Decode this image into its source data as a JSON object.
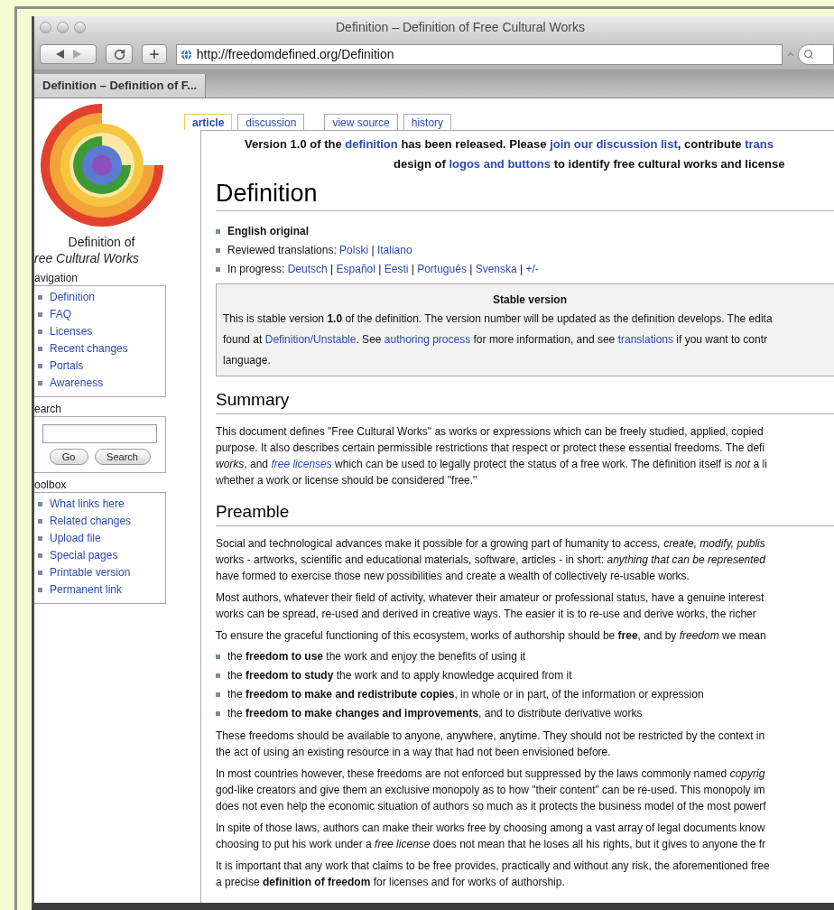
{
  "window": {
    "title": "Definition – Definition of Free Cultural Works"
  },
  "toolbar": {
    "url": "http://freedomdefined.org/Definition"
  },
  "browser_tabs": [
    {
      "label": "Definition – Definition of F...",
      "selected": true
    }
  ],
  "sidebar": {
    "site_name": "Definition of",
    "site_subtitle": "ree Cultural Works",
    "portlets": [
      {
        "kind": "links",
        "title": "avigation",
        "items": [
          "Definition",
          "FAQ",
          "Licenses",
          "Recent changes",
          "Portals",
          "Awareness"
        ]
      },
      {
        "kind": "search",
        "title": "earch",
        "buttons": [
          "Go",
          "Search"
        ]
      },
      {
        "kind": "links",
        "title": "oolbox",
        "items": [
          "What links here",
          "Related changes",
          "Upload file",
          "Special pages",
          "Printable version",
          "Permanent link"
        ]
      }
    ]
  },
  "page_tabs": [
    {
      "label": "article",
      "selected": true
    },
    {
      "label": "discussion",
      "selected": false
    },
    {
      "label": "view source",
      "selected": false
    },
    {
      "label": "history",
      "selected": false
    }
  ],
  "site_notice": [
    [
      {
        "kind": "text",
        "text": "Version 1.0 of the "
      },
      {
        "kind": "link",
        "text": "definition"
      },
      {
        "kind": "text",
        "text": " has been released. Please "
      },
      {
        "kind": "link",
        "text": "join our discussion list"
      },
      {
        "kind": "text",
        "text": ", contribute "
      },
      {
        "kind": "link",
        "text": "trans"
      }
    ],
    [
      {
        "kind": "text",
        "text": "design of "
      },
      {
        "kind": "link",
        "text": "logos and buttons"
      },
      {
        "kind": "text",
        "text": " to identify free cultural works and license"
      }
    ]
  ],
  "heading": "Definition",
  "languages": [
    [
      {
        "kind": "text",
        "text": "**English original**"
      }
    ],
    [
      {
        "kind": "text",
        "text": "Reviewed translations: "
      },
      {
        "kind": "link",
        "text": "Polski"
      },
      {
        "kind": "text",
        "text": " | "
      },
      {
        "kind": "link",
        "text": "Italiano"
      }
    ],
    [
      {
        "kind": "text",
        "text": "In progress: "
      },
      {
        "kind": "link",
        "text": "Deutsch"
      },
      {
        "kind": "text",
        "text": " | "
      },
      {
        "kind": "link",
        "text": "Español"
      },
      {
        "kind": "text",
        "text": " | "
      },
      {
        "kind": "link",
        "text": "Eesti"
      },
      {
        "kind": "text",
        "text": " | "
      },
      {
        "kind": "link",
        "text": "Português"
      },
      {
        "kind": "text",
        "text": " | "
      },
      {
        "kind": "link",
        "text": "Svenska"
      },
      {
        "kind": "text",
        "text": " | "
      },
      {
        "kind": "link",
        "text": "+/-"
      }
    ]
  ],
  "stable_box": {
    "title": "Stable version",
    "lines": [
      [
        {
          "kind": "text",
          "text": "This is stable version **1.0** of the definition. The version number will be updated as the definition develops. The edita"
        }
      ],
      [
        {
          "kind": "text",
          "text": "found at "
        },
        {
          "kind": "link",
          "text": "Definition/Unstable"
        },
        {
          "kind": "text",
          "text": ". See "
        },
        {
          "kind": "link",
          "text": "authoring process"
        },
        {
          "kind": "text",
          "text": " for more information, and see "
        },
        {
          "kind": "link",
          "text": "translations"
        },
        {
          "kind": "text",
          "text": " if you want to contr"
        }
      ],
      [
        {
          "kind": "text",
          "text": "language."
        }
      ]
    ]
  },
  "sections": [
    {
      "heading": "Summary",
      "blocks": [
        {
          "kind": "paragraph",
          "lines": [
            [
              {
                "kind": "text",
                "text": "This document defines \"Free Cultural Works\" as works or expressions which can be freely studied, applied, copied"
              }
            ],
            [
              {
                "kind": "text",
                "text": "purpose. It also describes certain permissible restrictions that respect or protect these essential freedoms. The defi"
              }
            ],
            [
              {
                "kind": "text",
                "text": "*works*, and "
              },
              {
                "kind": "link",
                "text": "*free licenses*"
              },
              {
                "kind": "text",
                "text": " which can be used to legally protect the status of a free work. The definition itself is *not* a li"
              }
            ],
            [
              {
                "kind": "text",
                "text": "whether a work or license should be considered \"free.\""
              }
            ]
          ]
        }
      ]
    },
    {
      "heading": "Preamble",
      "blocks": [
        {
          "kind": "paragraph",
          "lines": [
            [
              {
                "kind": "text",
                "text": "Social and technological advances make it possible for a growing part of humanity to *access, create, modify, publis*"
              }
            ],
            [
              {
                "kind": "text",
                "text": "works - artworks, scientific and educational materials, software, articles - in short: *anything that can be represented*"
              }
            ],
            [
              {
                "kind": "text",
                "text": "have formed to exercise those new possibilities and create a wealth of collectively re-usable works."
              }
            ]
          ]
        },
        {
          "kind": "paragraph",
          "lines": [
            [
              {
                "kind": "text",
                "text": "Most authors, whatever their field of activity, whatever their amateur or professional status, have a genuine interest"
              }
            ],
            [
              {
                "kind": "text",
                "text": "works can be spread, re-used and derived in creative ways. The easier it is to re-use and derive works, the richer"
              }
            ]
          ]
        },
        {
          "kind": "paragraph",
          "lines": [
            [
              {
                "kind": "text",
                "text": "To ensure the graceful functioning of this ecosystem, works of authorship should be **free**, and by *freedom* we mean"
              }
            ]
          ]
        },
        {
          "kind": "list",
          "lines": [
            [
              {
                "kind": "text",
                "text": "the **freedom to use** the work and enjoy the benefits of using it"
              }
            ],
            [
              {
                "kind": "text",
                "text": "the **freedom to study** the work and to apply knowledge acquired from it"
              }
            ],
            [
              {
                "kind": "text",
                "text": "the **freedom to make and redistribute copies**, in whole or in part, of the information or expression"
              }
            ],
            [
              {
                "kind": "text",
                "text": "the **freedom to make changes and improvements**, and to distribute derivative works"
              }
            ]
          ]
        },
        {
          "kind": "paragraph",
          "lines": [
            [
              {
                "kind": "text",
                "text": "These freedoms should be available to anyone, anywhere, anytime. They should not be restricted by the context in"
              }
            ],
            [
              {
                "kind": "text",
                "text": "the act of using an existing resource in a way that had not been envisioned before."
              }
            ]
          ]
        },
        {
          "kind": "paragraph",
          "lines": [
            [
              {
                "kind": "text",
                "text": "In most countries however, these freedoms are not enforced but suppressed by the laws commonly named *copyrig*"
              }
            ],
            [
              {
                "kind": "text",
                "text": "god-like creators and give them an exclusive monopoly as to how \"their content\" can be re-used. This monopoly im"
              }
            ],
            [
              {
                "kind": "text",
                "text": "does not even help the economic situation of authors so much as it protects the business model of the most powerf"
              }
            ]
          ]
        },
        {
          "kind": "paragraph",
          "lines": [
            [
              {
                "kind": "text",
                "text": "In spite of those laws, authors can make their works free by choosing among a vast array of legal documents know"
              }
            ],
            [
              {
                "kind": "text",
                "text": "choosing to put his work under a *free license* does not mean that he loses all his rights, but it gives to anyone the fr"
              }
            ]
          ]
        },
        {
          "kind": "paragraph",
          "lines": [
            [
              {
                "kind": "text",
                "text": "It is important that any work that claims to be free provides, practically and without any risk, the aforementioned free"
              }
            ],
            [
              {
                "kind": "text",
                "text": "a precise **definition of freedom** for licenses and for works of authorship."
              }
            ]
          ]
        }
      ]
    }
  ]
}
